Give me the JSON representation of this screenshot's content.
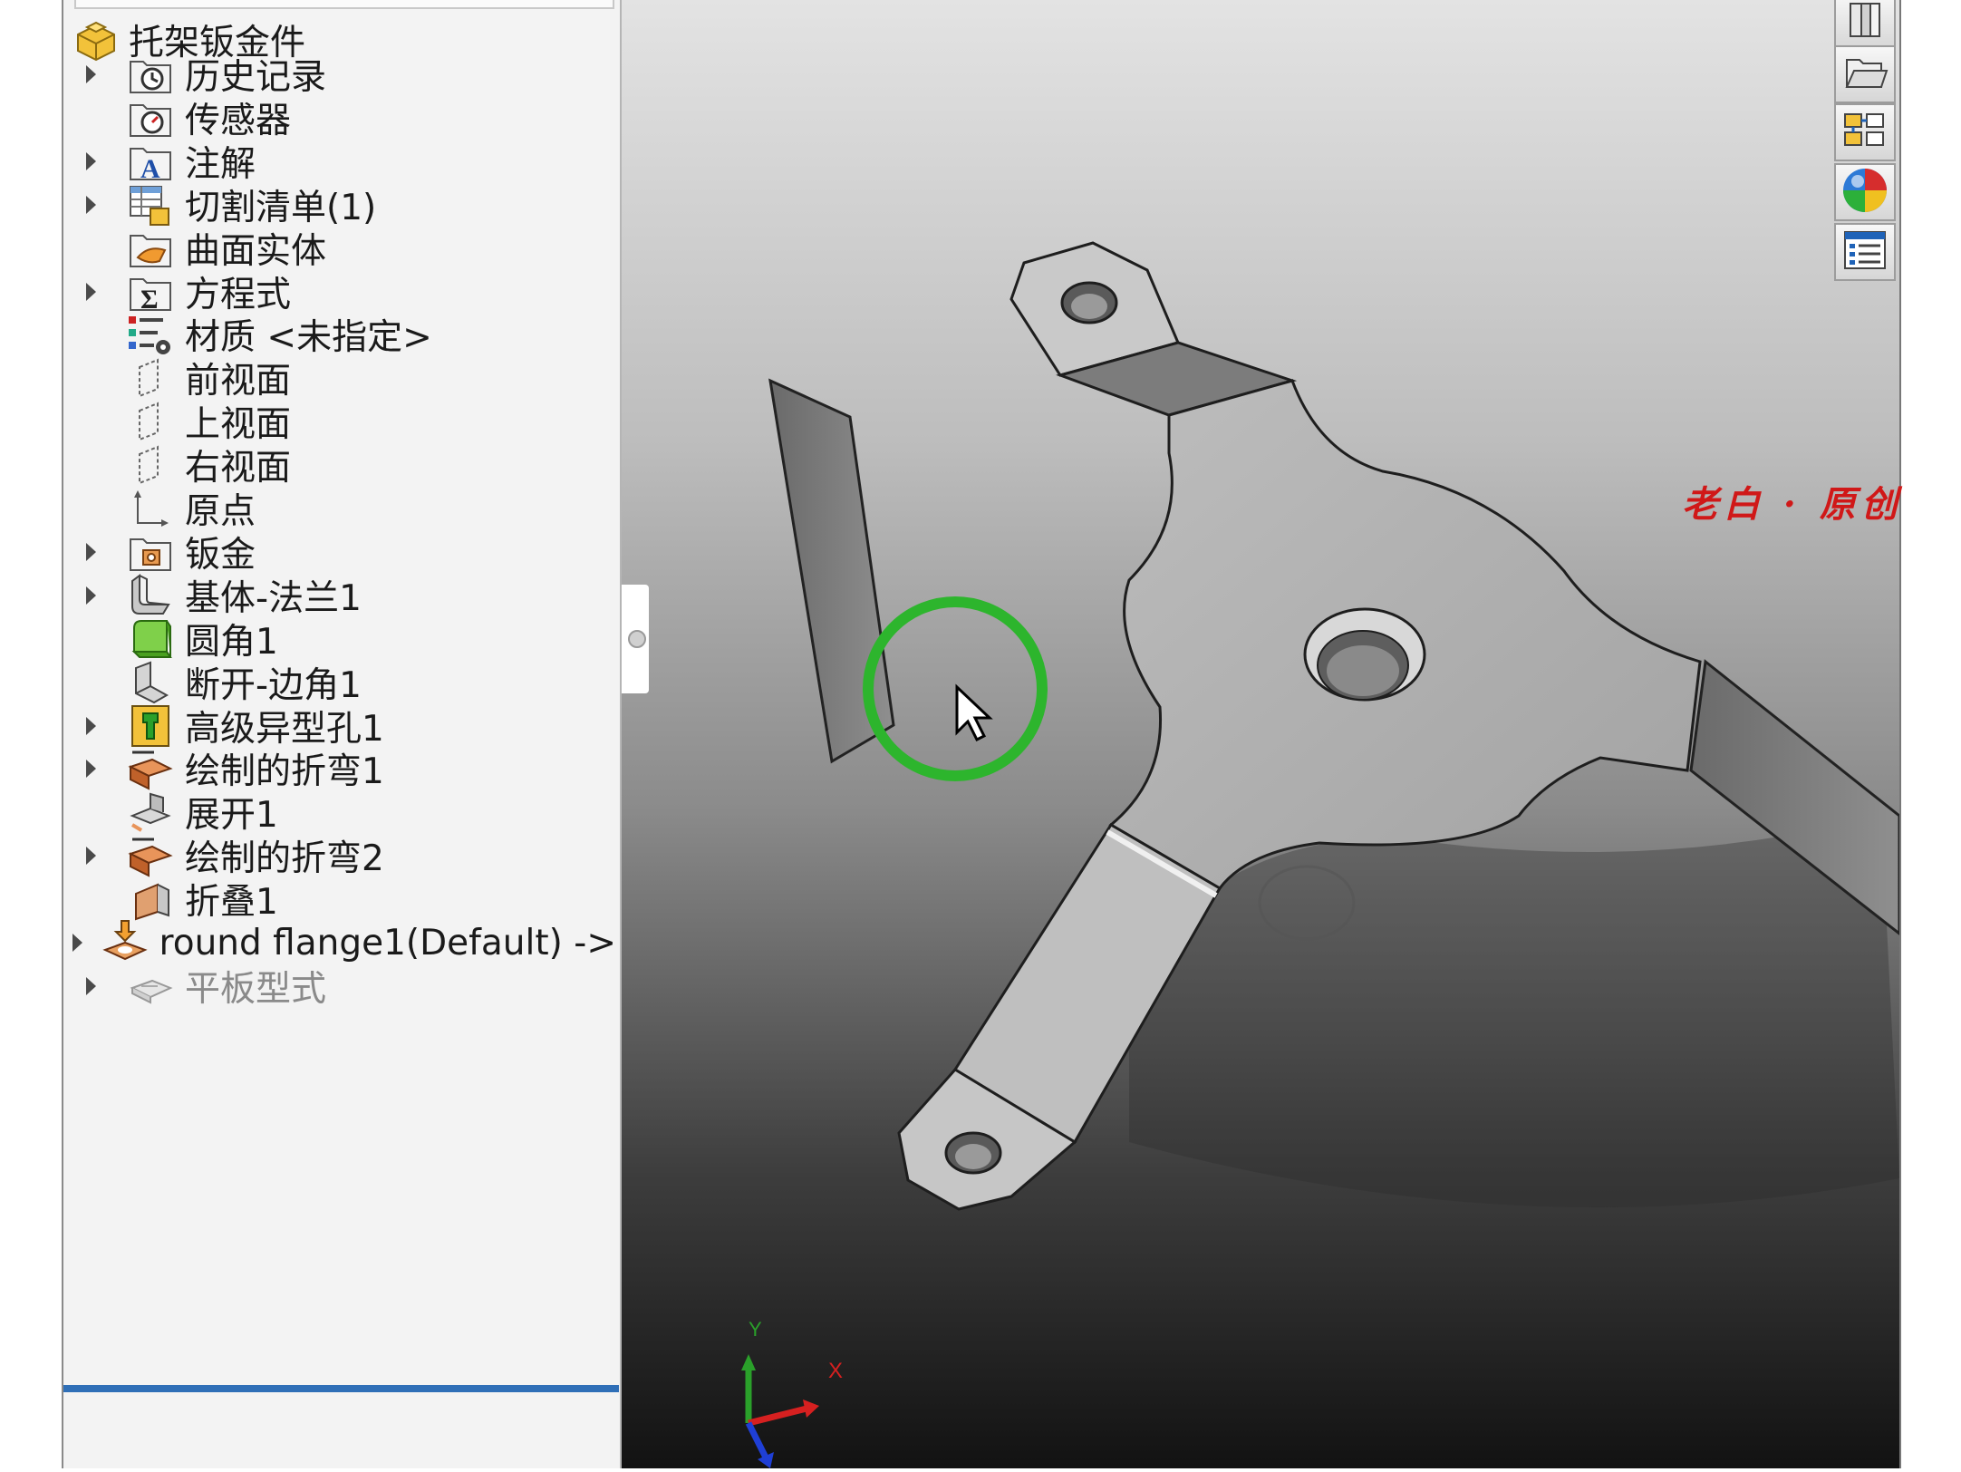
{
  "feature_tree": {
    "root": {
      "label": "托架钣金件",
      "icon": "part-icon"
    },
    "items": [
      {
        "label": "历史记录",
        "icon": "history-folder-icon",
        "expandable": true
      },
      {
        "label": "传感器",
        "icon": "sensor-folder-icon",
        "expandable": false
      },
      {
        "label": "注解",
        "icon": "annotations-folder-icon",
        "expandable": true
      },
      {
        "label": "切割清单(1)",
        "icon": "cut-list-icon",
        "expandable": true
      },
      {
        "label": "曲面实体",
        "icon": "surface-bodies-folder-icon",
        "expandable": false
      },
      {
        "label": "方程式",
        "icon": "equations-folder-icon",
        "expandable": true
      },
      {
        "label": "材质 <未指定>",
        "icon": "material-icon",
        "expandable": false
      },
      {
        "label": "前视面",
        "icon": "plane-icon",
        "expandable": false
      },
      {
        "label": "上视面",
        "icon": "plane-icon",
        "expandable": false
      },
      {
        "label": "右视面",
        "icon": "plane-icon",
        "expandable": false
      },
      {
        "label": "原点",
        "icon": "origin-icon",
        "expandable": false
      },
      {
        "label": "钣金",
        "icon": "sheet-metal-folder-icon",
        "expandable": true
      },
      {
        "label": "基体-法兰1",
        "icon": "base-flange-icon",
        "expandable": true
      },
      {
        "label": "圆角1",
        "icon": "fillet-icon",
        "expandable": false
      },
      {
        "label": "断开-边角1",
        "icon": "break-corner-icon",
        "expandable": false
      },
      {
        "label": "高级异型孔1",
        "icon": "hole-wizard-icon",
        "expandable": true
      },
      {
        "label": "绘制的折弯1",
        "icon": "sketched-bend-icon",
        "expandable": true
      },
      {
        "label": "展开1",
        "icon": "unfold-icon",
        "expandable": false
      },
      {
        "label": "绘制的折弯2",
        "icon": "sketched-bend-icon",
        "expandable": true
      },
      {
        "label": "折叠1",
        "icon": "fold-icon",
        "expandable": false
      },
      {
        "label": "round flange1(Default) ->",
        "icon": "forming-tool-icon",
        "expandable": true
      },
      {
        "label": "平板型式",
        "icon": "flat-pattern-icon",
        "expandable": true,
        "dimmed": true
      }
    ]
  },
  "task_pane": {
    "buttons": [
      "design-library-icon",
      "file-explorer-icon",
      "view-palette-icon",
      "appearances-icon",
      "custom-properties-icon"
    ]
  },
  "viewport": {
    "watermark": "老白 · 原创",
    "triad": {
      "x_label": "X",
      "y_label": "Y"
    }
  },
  "colors": {
    "selection_bar": "#2f6fb7",
    "cursor_ring": "#2db52d",
    "watermark": "#d01818"
  }
}
